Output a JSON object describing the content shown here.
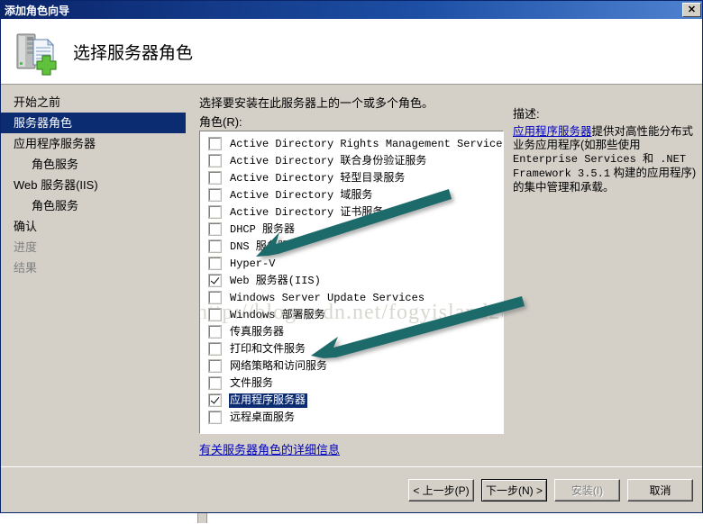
{
  "window": {
    "title": "添加角色向导",
    "close_label": "✕"
  },
  "header": {
    "title": "选择服务器角色",
    "icon": "server-add-icon"
  },
  "sidebar": {
    "items": [
      {
        "label": "开始之前",
        "state": "normal",
        "indent": false
      },
      {
        "label": "服务器角色",
        "state": "selected",
        "indent": false
      },
      {
        "label": "应用程序服务器",
        "state": "normal",
        "indent": false
      },
      {
        "label": "角色服务",
        "state": "normal",
        "indent": true
      },
      {
        "label": "Web 服务器(IIS)",
        "state": "normal",
        "indent": false
      },
      {
        "label": "角色服务",
        "state": "normal",
        "indent": true
      },
      {
        "label": "确认",
        "state": "normal",
        "indent": false
      },
      {
        "label": "进度",
        "state": "disabled",
        "indent": false
      },
      {
        "label": "结果",
        "state": "disabled",
        "indent": false
      }
    ]
  },
  "main": {
    "intro_text": "选择要安装在此服务器上的一个或多个角色。",
    "roles_label": "角色(R):",
    "details_link": "有关服务器角色的详细信息",
    "watermark": "http://blog.csdn.net/fogyisland2000",
    "roles": [
      {
        "label": "Active Directory Rights Management Services",
        "checked": false,
        "selected": false
      },
      {
        "label": "Active Directory 联合身份验证服务",
        "checked": false,
        "selected": false
      },
      {
        "label": "Active Directory 轻型目录服务",
        "checked": false,
        "selected": false
      },
      {
        "label": "Active Directory 域服务",
        "checked": false,
        "selected": false
      },
      {
        "label": "Active Directory 证书服务",
        "checked": false,
        "selected": false
      },
      {
        "label": "DHCP 服务器",
        "checked": false,
        "selected": false
      },
      {
        "label": "DNS 服务器",
        "checked": false,
        "selected": false
      },
      {
        "label": "Hyper-V",
        "checked": false,
        "selected": false
      },
      {
        "label": "Web 服务器(IIS)",
        "checked": true,
        "selected": false
      },
      {
        "label": "Windows Server Update Services",
        "checked": false,
        "selected": false
      },
      {
        "label": "Windows 部署服务",
        "checked": false,
        "selected": false
      },
      {
        "label": "传真服务器",
        "checked": false,
        "selected": false
      },
      {
        "label": "打印和文件服务",
        "checked": false,
        "selected": false
      },
      {
        "label": "网络策略和访问服务",
        "checked": false,
        "selected": false
      },
      {
        "label": "文件服务",
        "checked": false,
        "selected": false
      },
      {
        "label": "应用程序服务器",
        "checked": true,
        "selected": true
      },
      {
        "label": "远程桌面服务",
        "checked": false,
        "selected": false
      }
    ]
  },
  "description": {
    "title": "描述:",
    "link_text": "应用程序服务器",
    "text_part1": "提供对高性能分布式业务应用程序(如那些使用 ",
    "text_mono": "Enterprise Services 和 .NET Framework 3.5.1",
    "text_part2": " 构建的应用程序)的集中管理和承载。"
  },
  "footer": {
    "buttons": [
      {
        "label": "< 上一步(P)",
        "style": "normal"
      },
      {
        "label": "下一步(N) >",
        "style": "default"
      },
      {
        "label": "安装(I)",
        "style": "disabled"
      },
      {
        "label": "取消",
        "style": "normal"
      }
    ]
  },
  "annotations": {
    "arrow_color": "#1d6b6b",
    "arrow1_target": "Web 服务器(IIS)",
    "arrow2_target": "应用程序服务器"
  }
}
